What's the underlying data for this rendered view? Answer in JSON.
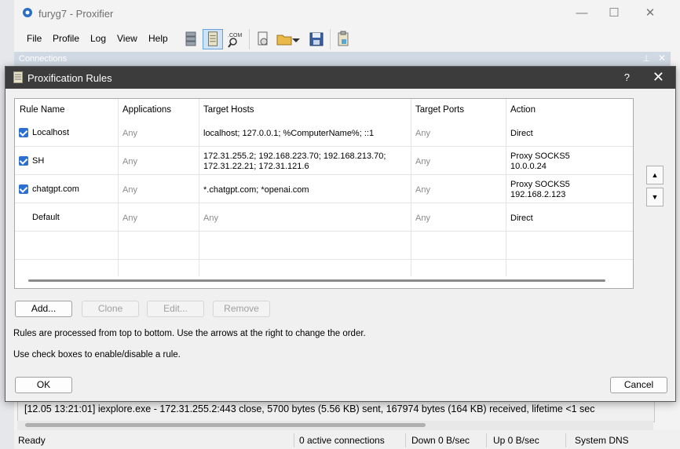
{
  "window": {
    "title": "furyg7 - Proxifier",
    "minimize_glyph": "—",
    "maximize_glyph": "☐",
    "close_glyph": "✕"
  },
  "menu": [
    "File",
    "Profile",
    "Log",
    "View",
    "Help"
  ],
  "connections_pane": {
    "label": "Connections"
  },
  "log_line": "[12.05 13:21:01] iexplore.exe - 172.31.255.2:443 close, 5700 bytes (5.56 KB) sent, 167974 bytes (164 KB) received, lifetime <1 sec",
  "status": {
    "state": "Ready",
    "connections": "0 active connections",
    "down": "Down 0 B/sec",
    "up": "Up 0 B/sec",
    "dns": "System DNS"
  },
  "dialog": {
    "title": "Proxification Rules",
    "help_glyph": "?",
    "close_glyph": "✕",
    "columns": [
      "Rule Name",
      "Applications",
      "Target Hosts",
      "Target Ports",
      "Action"
    ],
    "rows": [
      {
        "checked": true,
        "name": "Localhost",
        "apps": "Any",
        "hosts1": "localhost; 127.0.0.1; %ComputerName%; ::1",
        "hosts2": "",
        "ports": "Any",
        "action1": "Direct",
        "action2": ""
      },
      {
        "checked": true,
        "name": "SH",
        "apps": "Any",
        "hosts1": "172.31.255.2; 192.168.223.70; 192.168.213.70;",
        "hosts2": "172.31.22.21; 172.31.121.6",
        "ports": "Any",
        "action1": "Proxy SOCKS5",
        "action2": "10.0.0.24"
      },
      {
        "checked": true,
        "name": "chatgpt.com",
        "apps": "Any",
        "hosts1": "*.chatgpt.com; *openai.com",
        "hosts2": "",
        "ports": "Any",
        "action1": "Proxy SOCKS5",
        "action2": "192.168.2.123"
      },
      {
        "checked": false,
        "name": "Default",
        "apps": "Any",
        "hosts1": "Any",
        "hosts2": "",
        "ports": "Any",
        "action1": "Direct",
        "action2": ""
      }
    ],
    "buttons": {
      "add": "Add...",
      "clone": "Clone",
      "edit": "Edit...",
      "remove": "Remove",
      "ok": "OK",
      "cancel": "Cancel"
    },
    "move_up_glyph": "▲",
    "move_down_glyph": "▼",
    "info1": "Rules are processed from top to bottom. Use the arrows at the right to change the order.",
    "info2": "Use check boxes to enable/disable a rule."
  },
  "colors": {
    "dialog_title_bg": "#3c3c3c",
    "checkbox": "#2a6fd1",
    "toolbar_active": "#cfe3f6"
  }
}
